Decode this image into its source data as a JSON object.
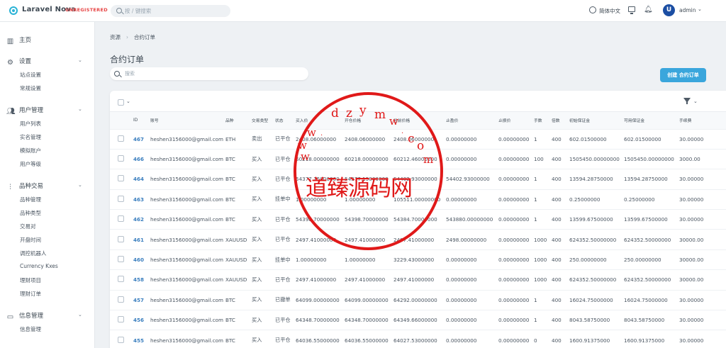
{
  "header": {
    "brand": "Laravel Nova",
    "unregistered": "UNREGISTERED",
    "search_placeholder": "按 / 键搜索",
    "language": "简体中文",
    "user": "admin",
    "avatar_letter": "U"
  },
  "sidebar": {
    "home": "主页",
    "settings": {
      "label": "设置",
      "items": [
        "站点设置",
        "常规设置"
      ]
    },
    "users": {
      "label": "用户管理",
      "items": [
        "用户列表",
        "实名管理",
        "模拟账户",
        "用户等级"
      ]
    },
    "trade": {
      "label": "品种交易",
      "items": [
        "品种管理",
        "品种类型",
        "交易对",
        "开盘时间",
        "调控机器人",
        "Currency Kxes",
        "理财项目",
        "理财订单"
      ]
    },
    "info": {
      "label": "信息管理",
      "items": [
        "信息管理"
      ]
    }
  },
  "main": {
    "breadcrumb": [
      "资源",
      "合约订单"
    ],
    "title": "合约订单",
    "search_placeholder": "搜索",
    "create_button": "创建 合约订单"
  },
  "table": {
    "columns": [
      "ID",
      "账号",
      "品种",
      "交易类型",
      "状态",
      "买入价",
      "开仓价格",
      "当前价格",
      "止盈价",
      "止损价",
      "手数",
      "倍数",
      "初始保证金",
      "可用保证金",
      "手续费"
    ],
    "rows": [
      [
        "467",
        "heshen3156000@gmail.com",
        "ETH",
        "卖出",
        "已平仓",
        "2408.06000000",
        "2408.06000000",
        "2408.06000000",
        "0.00000000",
        "0.00000000",
        "1",
        "400",
        "602.01500000",
        "602.01500000",
        "30.00000"
      ],
      [
        "466",
        "heshen3156000@gmail.com",
        "BTC",
        "买入",
        "已平仓",
        "60218.00000000",
        "60218.00000000",
        "60212.46000000",
        "0.00000000",
        "0.00000000",
        "100",
        "400",
        "1505450.00000000",
        "1505450.00000000",
        "3000.00"
      ],
      [
        "464",
        "heshen3156000@gmail.com",
        "BTC",
        "买入",
        "已平仓",
        "54377.15000000",
        "54377.15000000",
        "54402.93000000",
        "54402.93000000",
        "0.00000000",
        "1",
        "400",
        "13594.28750000",
        "13594.28750000",
        "30.00000"
      ],
      [
        "463",
        "heshen3156000@gmail.com",
        "BTC",
        "买入",
        "挂单中",
        "1.00000000",
        "1.00000000",
        "105511.00000000",
        "0.00000000",
        "0.00000000",
        "1",
        "400",
        "0.25000000",
        "0.25000000",
        "30.00000"
      ],
      [
        "462",
        "heshen3156000@gmail.com",
        "BTC",
        "买入",
        "已平仓",
        "54398.70000000",
        "54398.70000000",
        "54384.70000000",
        "543880.00000000",
        "0.00000000",
        "1",
        "400",
        "13599.67500000",
        "13599.67500000",
        "30.00000"
      ],
      [
        "461",
        "heshen3156000@gmail.com",
        "XAUUSD",
        "买入",
        "已平仓",
        "2497.41000000",
        "2497.41000000",
        "2497.41000000",
        "2498.00000000",
        "0.00000000",
        "1000",
        "400",
        "624352.50000000",
        "624352.50000000",
        "30000.00"
      ],
      [
        "460",
        "heshen3156000@gmail.com",
        "XAUUSD",
        "买入",
        "挂单中",
        "1.00000000",
        "1.00000000",
        "3229.43000000",
        "0.00000000",
        "0.00000000",
        "1000",
        "400",
        "250.00000000",
        "250.00000000",
        "30000.00"
      ],
      [
        "458",
        "heshen3156000@gmail.com",
        "XAUUSD",
        "买入",
        "已平仓",
        "2497.41000000",
        "2497.41000000",
        "2497.41000000",
        "0.00000000",
        "0.00000000",
        "1000",
        "400",
        "624352.50000000",
        "624352.50000000",
        "30000.00"
      ],
      [
        "457",
        "heshen3156000@gmail.com",
        "BTC",
        "买入",
        "已撤单",
        "64099.00000000",
        "64099.00000000",
        "64292.00000000",
        "0.00000000",
        "0.00000000",
        "1",
        "400",
        "16024.75000000",
        "16024.75000000",
        "30.00000"
      ],
      [
        "456",
        "heshen3156000@gmail.com",
        "BTC",
        "买入",
        "已平仓",
        "64348.70000000",
        "64348.70000000",
        "64349.66000000",
        "0.00000000",
        "0.00000000",
        "1",
        "400",
        "8043.58750000",
        "8043.58750000",
        "30.00000"
      ],
      [
        "455",
        "heshen3156000@gmail.com",
        "BTC",
        "买入",
        "已平仓",
        "64036.55000000",
        "64036.55000000",
        "64027.53000000",
        "0.00000000",
        "0.00000000",
        "0",
        "400",
        "1600.91375000",
        "1600.91375000",
        "30.00000"
      ]
    ]
  },
  "watermark": {
    "main": "道臻源码网",
    "domain_chars": [
      "w",
      "w",
      "w",
      ".",
      "d",
      "z",
      "y",
      "m",
      "w",
      ".",
      "c",
      "o",
      "m"
    ]
  },
  "colors": {
    "accent": "#3aa6dc",
    "link": "#3b7fbf",
    "brand": "#2ab3d6",
    "warning": "#e74444",
    "stamp": "#e01919"
  }
}
